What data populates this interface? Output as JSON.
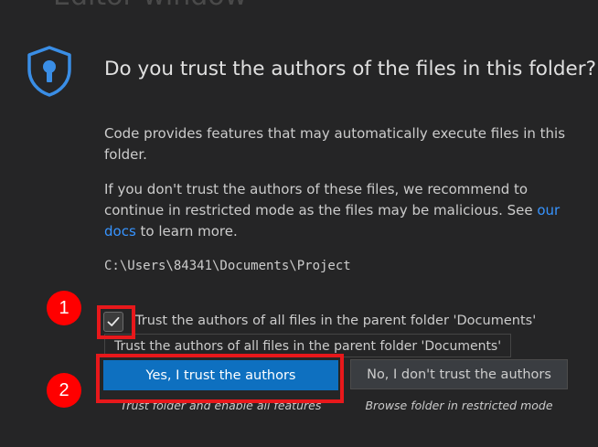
{
  "background_title": "Editor window",
  "dialog": {
    "title": "Do you trust the authors of the files in this folder?",
    "message1": "Code provides features that may automatically execute files in this folder.",
    "message2_before_link": "If you don't trust the authors of these files, we recommend to continue in restricted mode as the files may be malicious. See ",
    "message2_link": "our docs",
    "message2_after_link": " to learn more.",
    "path": "C:\\Users\\84341\\Documents\\Project",
    "checkbox": {
      "label": "Trust the authors of all files in the parent folder 'Documents'",
      "checked": true
    },
    "tooltip": "Trust the authors of all files in the parent folder 'Documents'",
    "primary_button": {
      "label": "Yes, I trust the authors",
      "sublabel": "Trust folder and enable all features"
    },
    "secondary_button": {
      "label": "No, I don't trust the authors",
      "sublabel": "Browse folder in restricted mode"
    }
  },
  "annotations": {
    "step1": "1",
    "step2": "2"
  },
  "colors": {
    "background": "#252526",
    "primary_button": "#0e70c0",
    "link": "#3794ff",
    "shield": "#3a8ee6",
    "highlight": "#e8181b"
  },
  "icons": {
    "trust": "shield-lock-icon",
    "checkbox": "checkmark-icon"
  }
}
